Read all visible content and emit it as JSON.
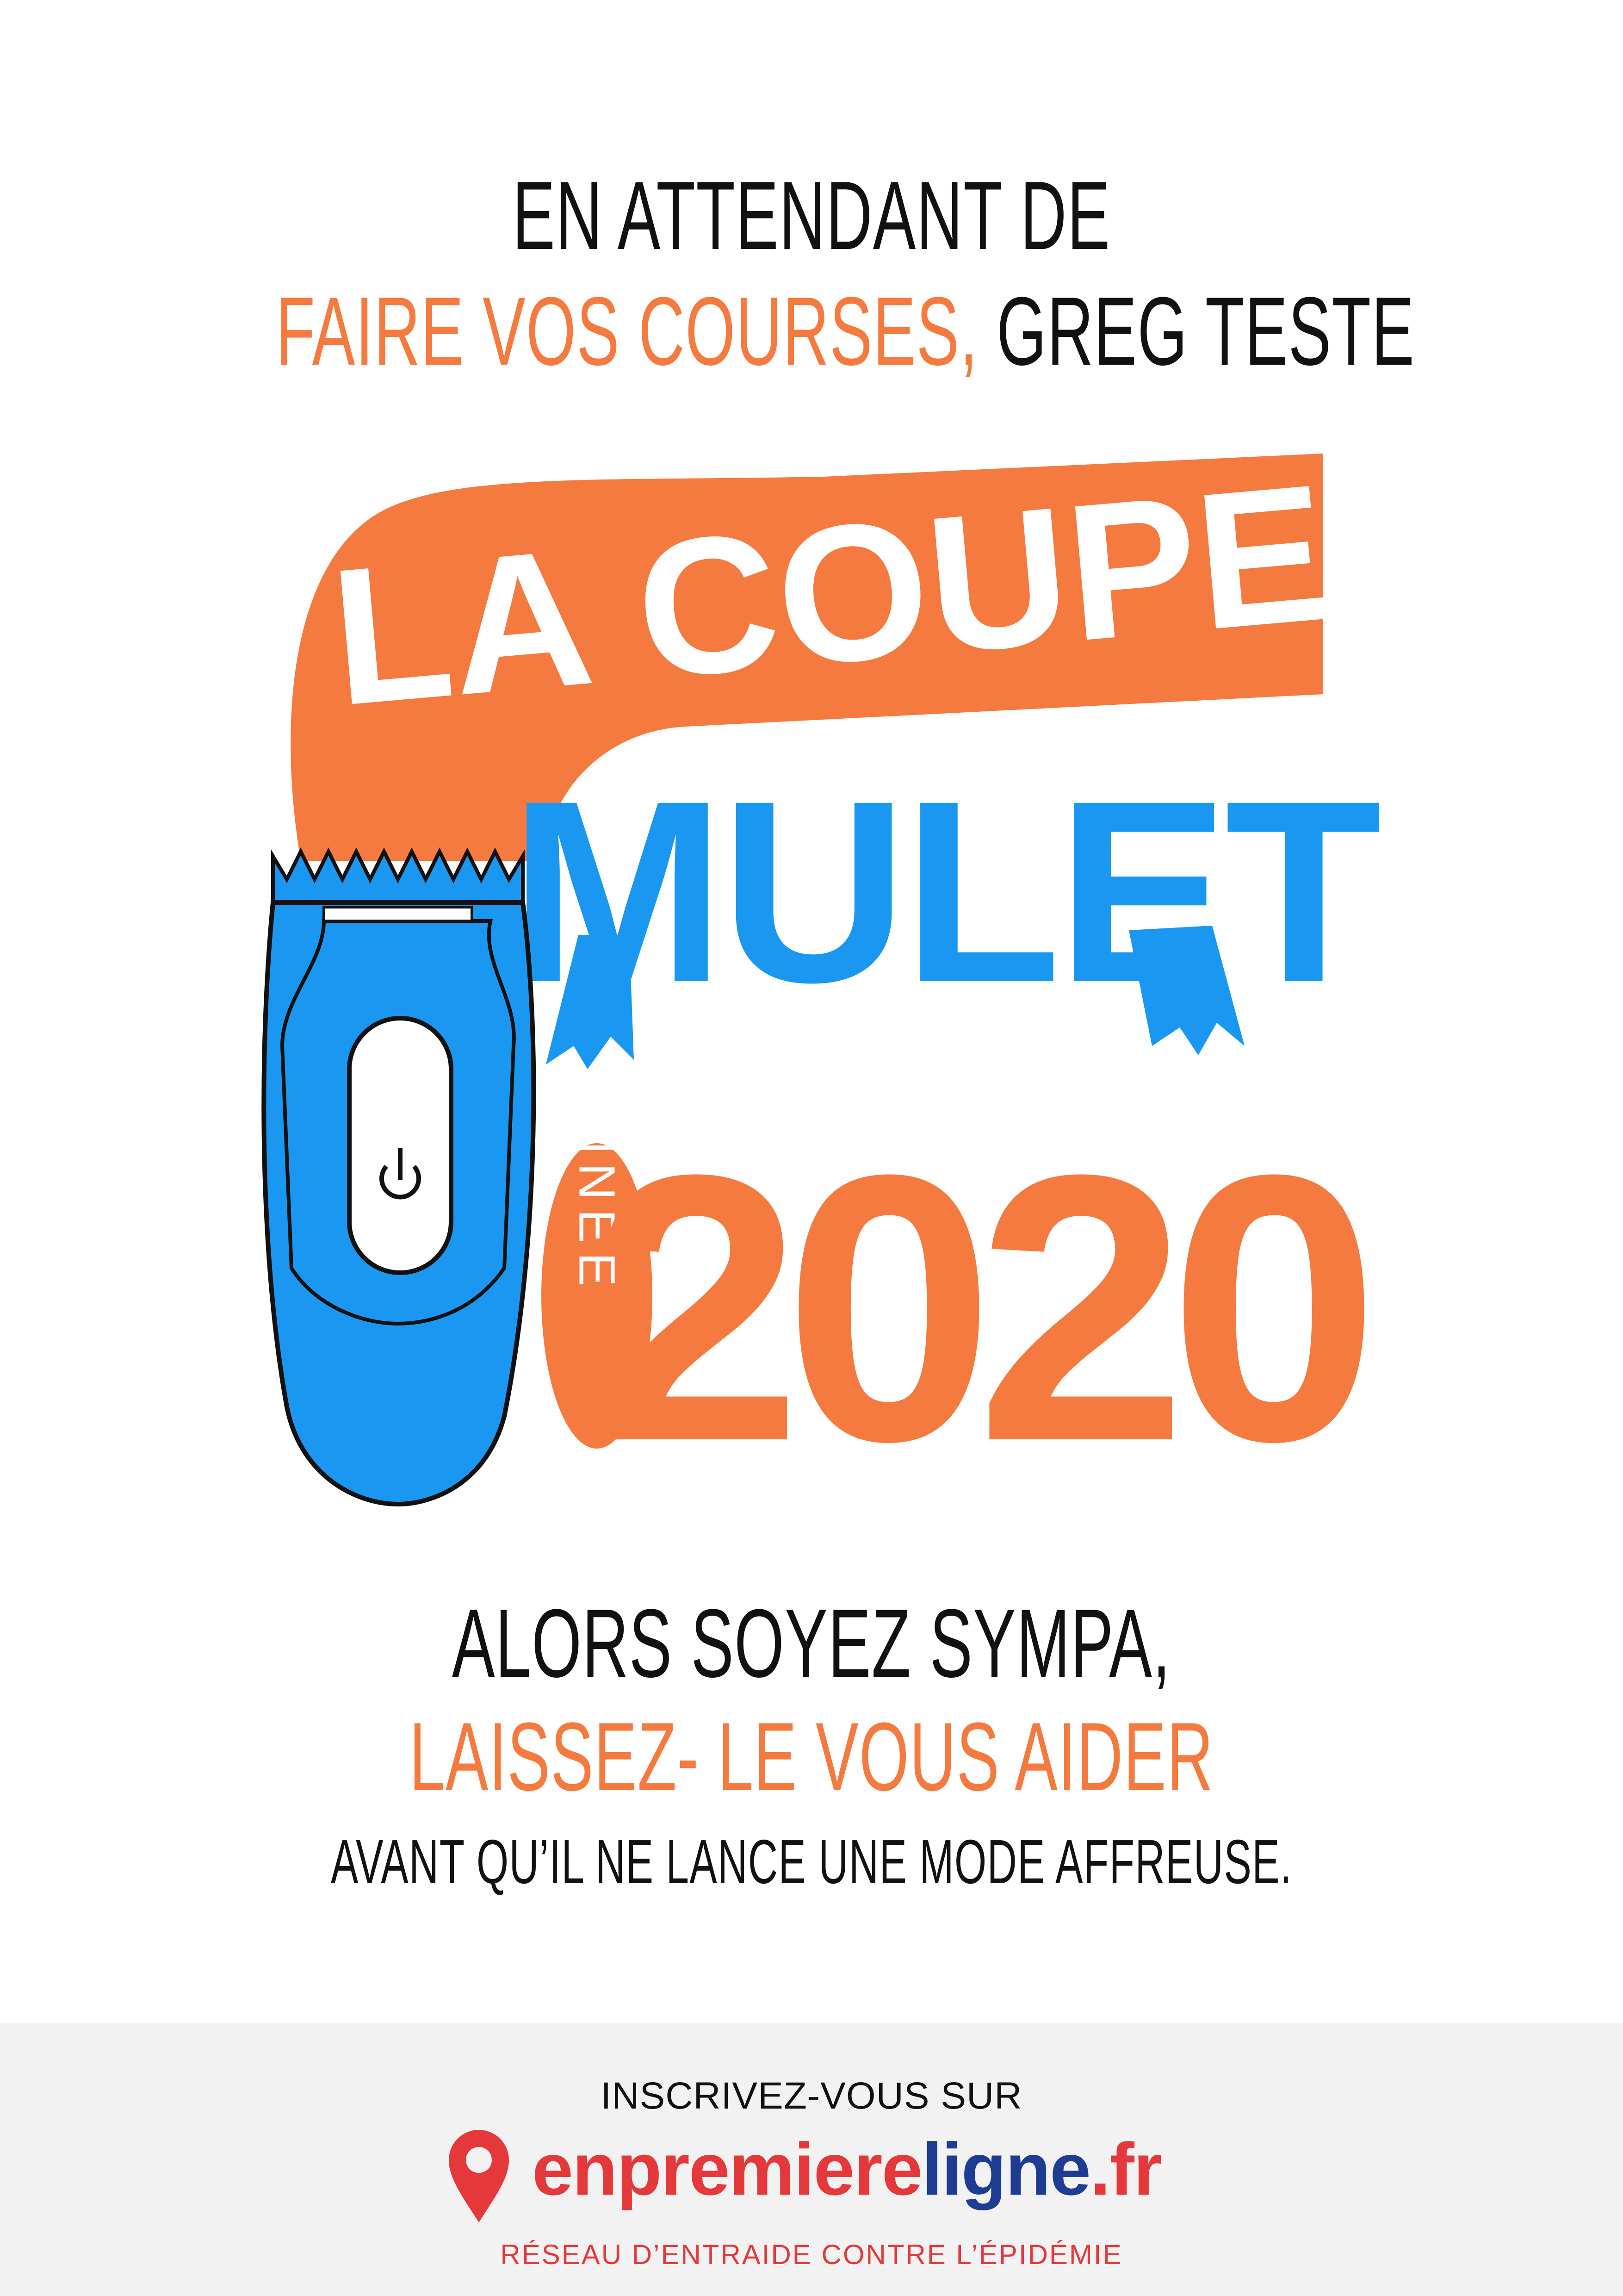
{
  "headline": {
    "line1": "EN ATTENDANT DE",
    "line2_highlight": "FAIRE VOS COURSES,",
    "line2_rest": "GREG TESTE"
  },
  "illustration": {
    "banner_text": "LA COUPE",
    "mulet_text": "MULET",
    "annee_text": "ANNÉE",
    "year_text": "2020"
  },
  "message": {
    "line1": "ALORS SOYEZ SYMPA,",
    "line2": "LAISSEZ- LE VOUS AIDER",
    "line3": "AVANT QU’IL NE LANCE UNE MODE AFFREUSE."
  },
  "footer": {
    "cta": "INSCRIVEZ-VOUS SUR",
    "brand_part1": "enpremiere",
    "brand_part2": "ligne",
    "brand_part3": ".fr",
    "tagline": "RÉSEAU D’ENTRAIDE CONTRE L’ÉPIDÉMIE"
  },
  "colors": {
    "orange": "#f47a3f",
    "blue": "#1a97f0",
    "red": "#e5383b",
    "navy": "#1f3c93"
  },
  "icons": {
    "clipper": "hair-clipper-icon",
    "power": "power-icon",
    "pin": "map-pin-icon"
  }
}
